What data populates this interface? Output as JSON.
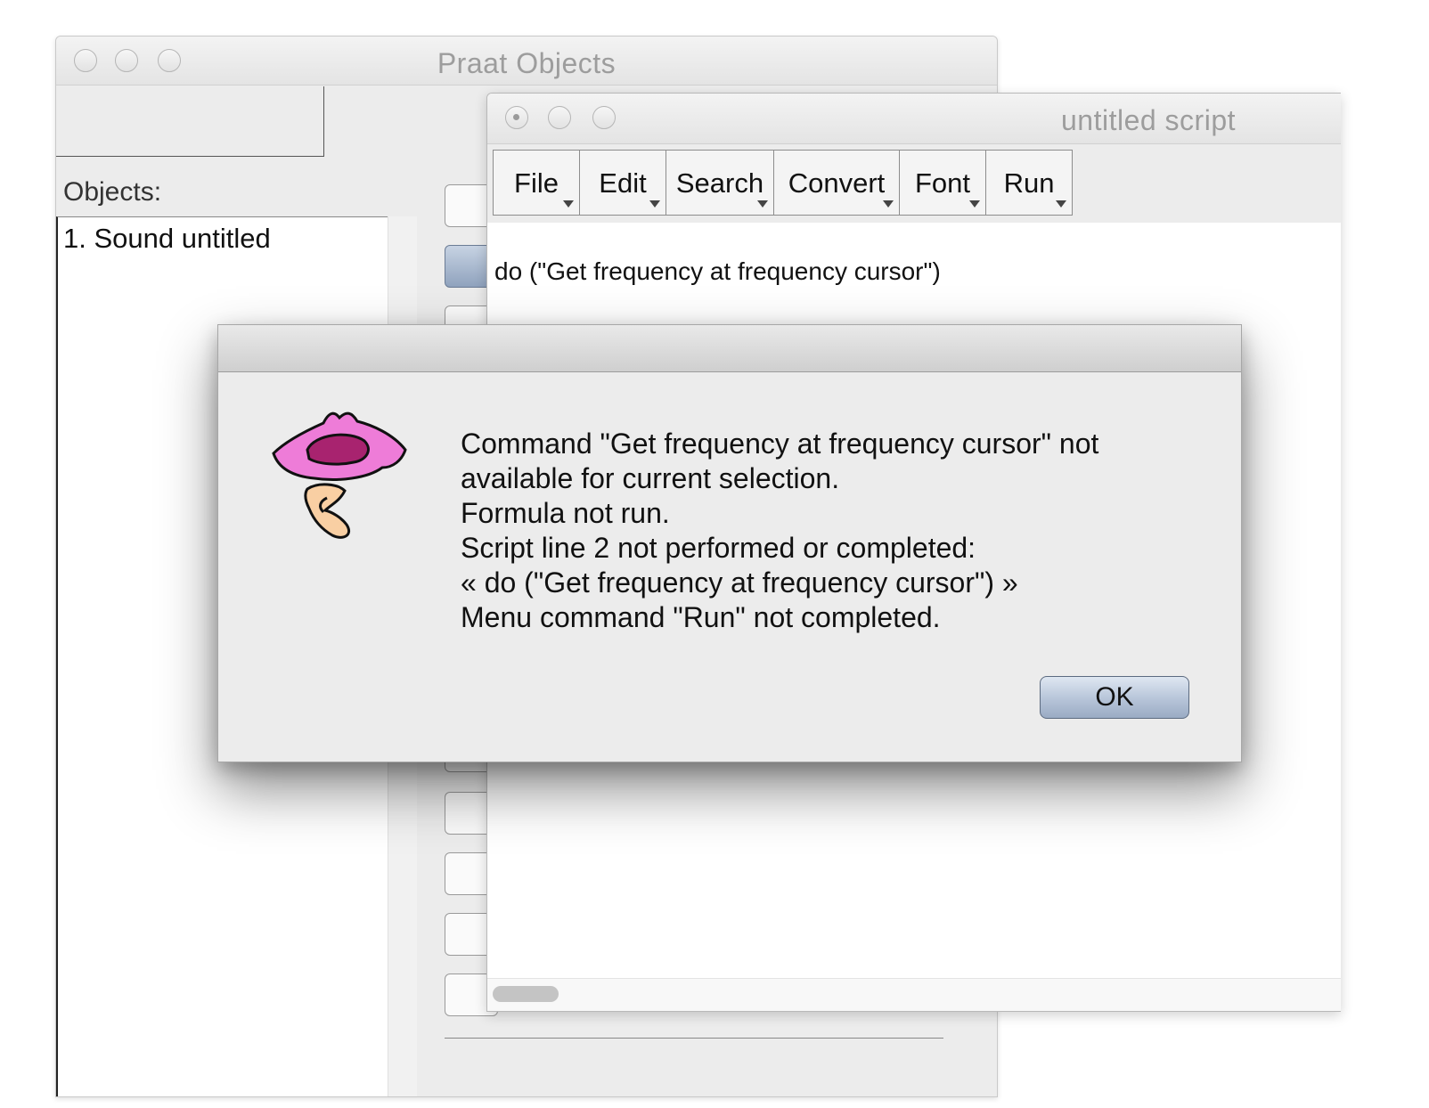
{
  "praat_objects_window": {
    "title": "Praat Objects",
    "objects_label": "Objects:",
    "objects": [
      "1. Sound untitled"
    ]
  },
  "script_window": {
    "title": "untitled script",
    "menus": [
      "File",
      "Edit",
      "Search",
      "Convert",
      "Font",
      "Run"
    ],
    "script_line": "do (\"Get frequency at frequency cursor\")"
  },
  "error_dialog": {
    "icon": "praat-mouth-ear-icon",
    "message_lines": [
      "Command \"Get frequency at frequency cursor\" not",
      "available for current selection.",
      "Formula not run.",
      "Script line 2 not performed or completed:",
      "« do (\"Get frequency at frequency cursor\") »",
      "Menu command \"Run\" not completed."
    ],
    "ok_label": "OK"
  }
}
